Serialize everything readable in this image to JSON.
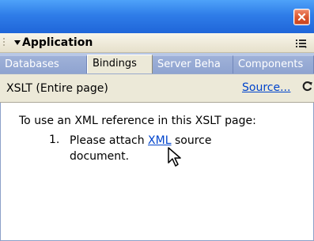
{
  "window": {
    "close_icon": "close-icon",
    "title_color": "#2f7de8"
  },
  "panel": {
    "title": "Application",
    "menu_icon": "panel-menu-icon",
    "collapse_icon": "triangle-down-icon"
  },
  "tabs": [
    {
      "label": "Databases",
      "selected": false
    },
    {
      "label": "Bindings",
      "selected": true
    },
    {
      "label": "Server Beha",
      "selected": false
    },
    {
      "label": "Components",
      "selected": false
    }
  ],
  "bindings": {
    "page_type": "XSLT (Entire page)",
    "source_link": "Source...",
    "refresh_icon": "refresh-icon"
  },
  "message": {
    "instruction": "To use an XML reference in this XSLT page:",
    "step_number": "1.",
    "step_before_link": "Please attach ",
    "step_link": "XML",
    "step_after_link": " source",
    "step_second_line": "document."
  },
  "colors": {
    "link": "#0044cc",
    "tab_bar": "#b8c8e6",
    "panel_background": "#ece9d8",
    "close_button": "#d9532b"
  }
}
